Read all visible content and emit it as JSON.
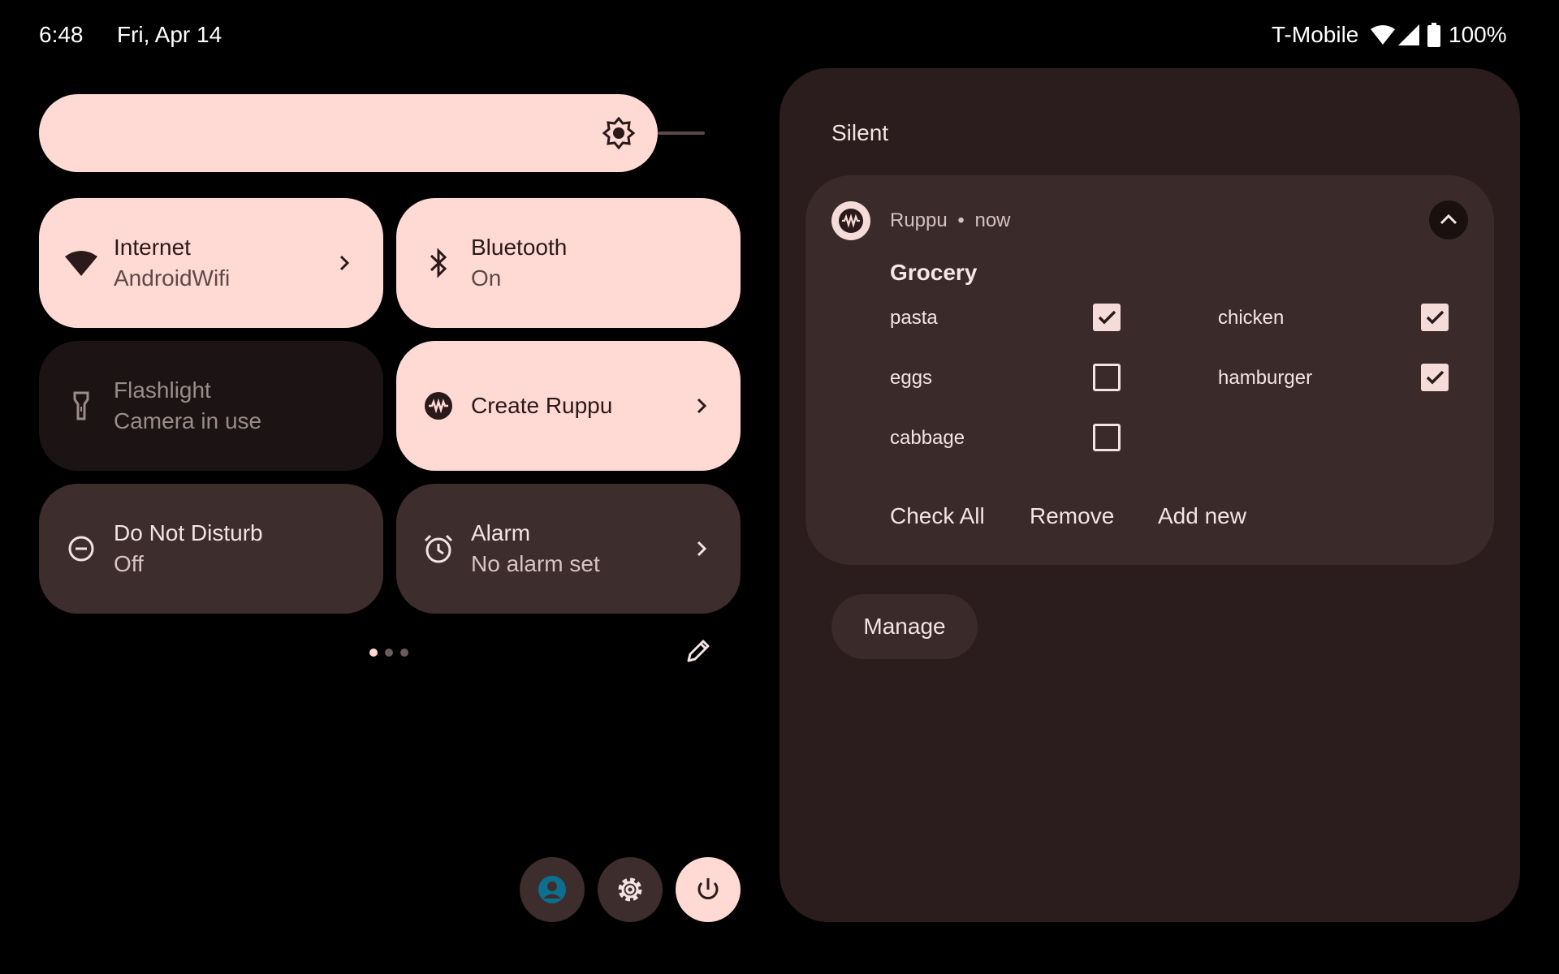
{
  "status_bar": {
    "time": "6:48",
    "date": "Fri, Apr 14",
    "carrier": "T-Mobile",
    "battery": "100%",
    "icons": [
      "wifi-icon",
      "signal-icon",
      "battery-icon"
    ]
  },
  "brightness": {
    "icon": "brightness-icon"
  },
  "tiles": {
    "internet": {
      "title": "Internet",
      "subtitle": "AndroidWifi",
      "icon": "wifi-icon",
      "state": "on"
    },
    "bluetooth": {
      "title": "Bluetooth",
      "subtitle": "On",
      "icon": "bluetooth-icon",
      "state": "on"
    },
    "flashlight": {
      "title": "Flashlight",
      "subtitle": "Camera in use",
      "icon": "flashlight-icon",
      "state": "unavailable"
    },
    "create_ruppu": {
      "title": "Create Ruppu",
      "icon": "ruppu-icon",
      "state": "on"
    },
    "dnd": {
      "title": "Do Not Disturb",
      "subtitle": "Off",
      "icon": "dnd-icon",
      "state": "off"
    },
    "alarm": {
      "title": "Alarm",
      "subtitle": "No alarm set",
      "icon": "alarm-icon",
      "state": "off"
    }
  },
  "pager": {
    "pages": 3,
    "current": 1
  },
  "bottom_buttons": {
    "user": "user-icon",
    "settings": "gear-icon",
    "power": "power-icon"
  },
  "notifications": {
    "section_title": "Silent",
    "card": {
      "app_name": "Ruppu",
      "separator": "•",
      "time": "now",
      "title": "Grocery",
      "items": [
        {
          "label": "pasta",
          "checked": true
        },
        {
          "label": "chicken",
          "checked": true
        },
        {
          "label": "eggs",
          "checked": false
        },
        {
          "label": "hamburger",
          "checked": true
        },
        {
          "label": "cabbage",
          "checked": false
        }
      ],
      "actions": {
        "check_all": "Check All",
        "remove": "Remove",
        "add_new": "Add new"
      }
    },
    "manage_label": "Manage"
  },
  "colors": {
    "tile_on": "#ffd9d4",
    "tile_off": "#3d2d2c",
    "shade_bg": "#2b1d1d",
    "card_bg": "#3a2b2a",
    "accent_user": "#0b6f8f"
  }
}
